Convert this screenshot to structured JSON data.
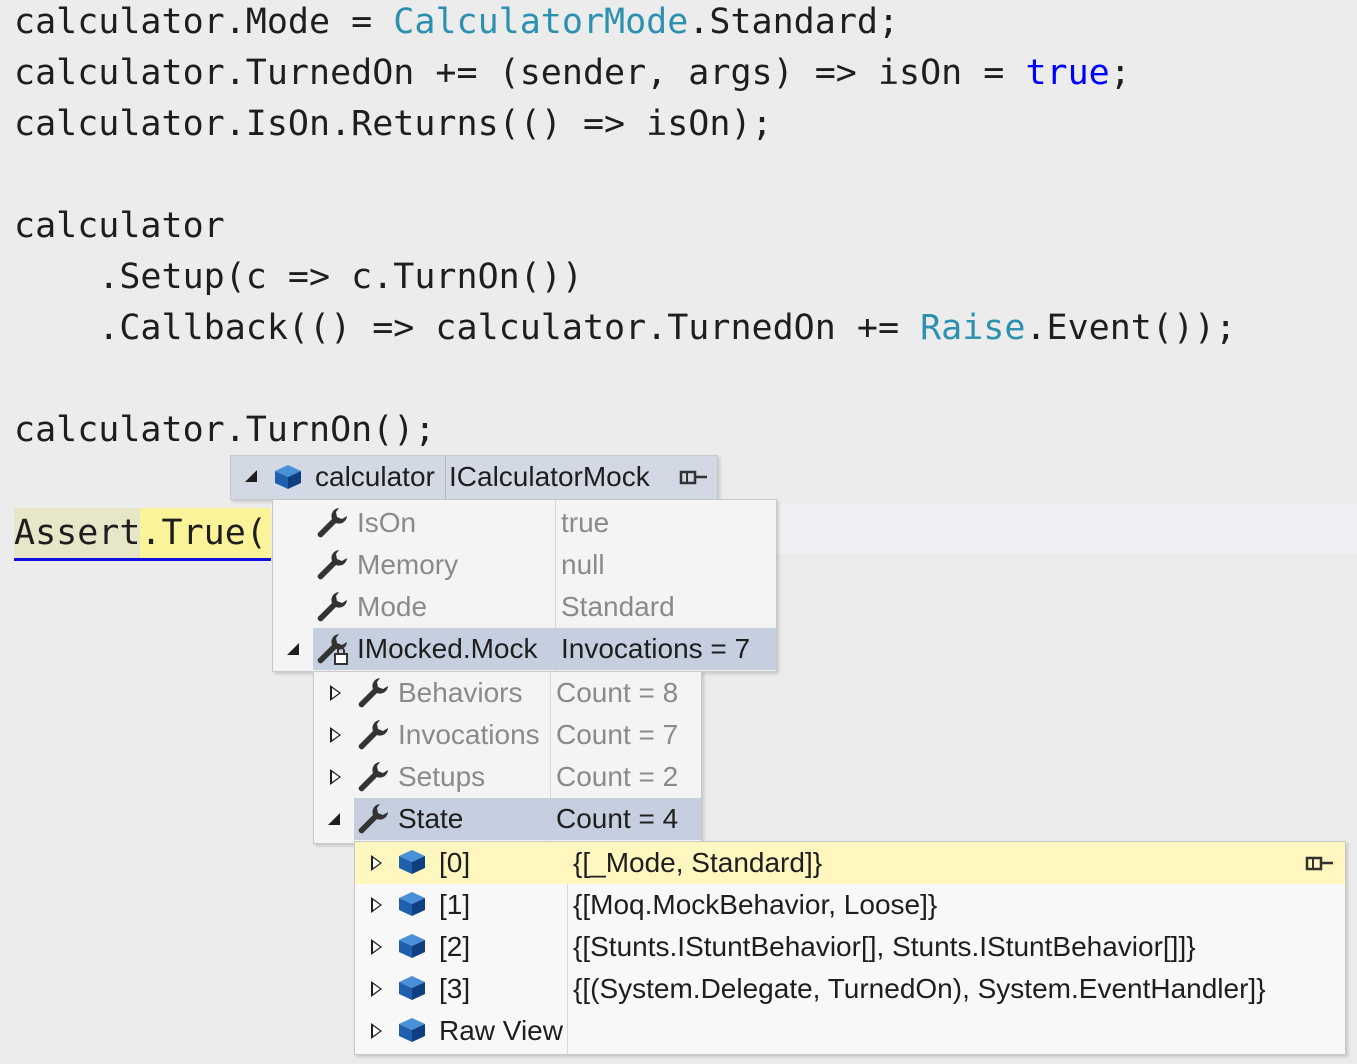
{
  "code": {
    "line1": {
      "a": "calculator.Mode = ",
      "type": "CalculatorMode",
      "b": ".Standard;"
    },
    "line2": {
      "a": "calculator.TurnedOn += (sender, args) => isOn = ",
      "kw": "true",
      "b": ";"
    },
    "line3": "calculator.IsOn.Returns(() => isOn);",
    "line4": "calculator",
    "line5": "    .Setup(c => c.TurnOn())",
    "line6": {
      "a": "    .Callback(() => calculator.TurnedOn += ",
      "type": "Raise",
      "b": ".Event());"
    },
    "line7": "calculator.TurnOn();",
    "assert_a": "Assert",
    "assert_b": ".True("
  },
  "datatip": {
    "root": {
      "name": "calculator",
      "type": "ICalculatorMock"
    },
    "members": [
      {
        "name": "IsOn",
        "value": "true"
      },
      {
        "name": "Memory",
        "value": "null"
      },
      {
        "name": "Mode",
        "value": "Standard"
      },
      {
        "name": "IMocked.Mock",
        "value": "Invocations = 7"
      }
    ],
    "mock_members": [
      {
        "name": "Behaviors",
        "value": "Count = 8"
      },
      {
        "name": "Invocations",
        "value": "Count = 7"
      },
      {
        "name": "Setups",
        "value": "Count = 2"
      },
      {
        "name": "State",
        "value": "Count = 4"
      }
    ],
    "state_items": [
      {
        "name": "[0]",
        "value": "{[_Mode, Standard]}"
      },
      {
        "name": "[1]",
        "value": "{[Moq.MockBehavior, Loose]}"
      },
      {
        "name": "[2]",
        "value": "{[Stunts.IStuntBehavior[], Stunts.IStuntBehavior[]]}"
      },
      {
        "name": "[3]",
        "value": "{[(System.Delegate, TurnedOn), System.EventHandler]}"
      },
      {
        "name": "Raw View",
        "value": ""
      }
    ]
  },
  "icons": {
    "member": "wrench-icon",
    "object": "object-cube-icon",
    "pin": "pin-icon",
    "lock": "lock-icon"
  },
  "colors": {
    "type": "#2b91af",
    "keyword": "#0000ff",
    "selection": "#c5cfe0",
    "highlight": "#fff6c0",
    "object": "#1e6fc4"
  }
}
